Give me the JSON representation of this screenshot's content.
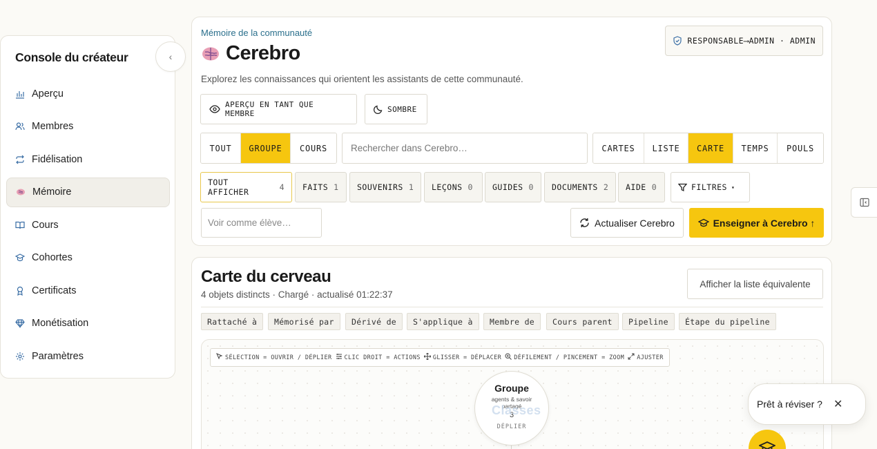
{
  "sidebar": {
    "title": "Console du créateur",
    "collapse_icon": "chevron-left-icon",
    "items": [
      {
        "label": "Aperçu",
        "icon": "bar-chart-icon"
      },
      {
        "label": "Membres",
        "icon": "users-icon"
      },
      {
        "label": "Fidélisation",
        "icon": "repeat-icon"
      },
      {
        "label": "Mémoire",
        "icon": "brain-icon",
        "active": true
      },
      {
        "label": "Cours",
        "icon": "book-icon"
      },
      {
        "label": "Cohortes",
        "icon": "graduation-cap-icon"
      },
      {
        "label": "Certificats",
        "icon": "award-icon"
      },
      {
        "label": "Monétisation",
        "icon": "gem-icon"
      },
      {
        "label": "Paramètres",
        "icon": "gear-icon"
      }
    ]
  },
  "header": {
    "eyebrow": "Mémoire de la communauté",
    "title": "Cerebro",
    "description": "Explorez les connaissances qui orientent les assistants de cette communauté.",
    "role_badge": "RESPONSABLE⟶ADMIN · ADMIN",
    "preview_btn": "APERÇU EN TANT QUE MEMBRE",
    "theme_btn": "SOMBRE"
  },
  "scope_tabs": [
    "TOUT",
    "GROUPE",
    "COURS"
  ],
  "scope_active": "GROUPE",
  "search": {
    "placeholder": "Rechercher dans Cerebro…"
  },
  "view_tabs": [
    "CARTES",
    "LISTE",
    "CARTE",
    "TEMPS",
    "POULS"
  ],
  "view_active": "CARTE",
  "filters": [
    {
      "label": "TOUT AFFICHER",
      "count": "4"
    },
    {
      "label": "FAITS",
      "count": "1"
    },
    {
      "label": "SOUVENIRS",
      "count": "1"
    },
    {
      "label": "LEÇONS",
      "count": "0"
    },
    {
      "label": "GUIDES",
      "count": "0"
    },
    {
      "label": "DOCUMENTS",
      "count": "2"
    },
    {
      "label": "AIDE",
      "count": "0"
    }
  ],
  "filters_btn": "FILTRES",
  "student_input": {
    "placeholder": "Voir comme élève…"
  },
  "refresh_btn": "Actualiser Cerebro",
  "teach_btn": "Enseigner à Cerebro ↑",
  "map": {
    "title": "Carte du cerveau",
    "subtitle": "4 objets distincts · Chargé · actualisé 01:22:37",
    "list_btn": "Afficher la liste équivalente",
    "relations": [
      "Rattaché à",
      "Mémorisé par",
      "Dérivé de",
      "S'applique à",
      "Membre de",
      "Cours parent",
      "Pipeline",
      "Étape du pipeline"
    ],
    "hints": [
      {
        "icon": "pointer-icon",
        "text": "SÉLECTION = OUVRIR / DÉPLIER"
      },
      {
        "icon": "sliders-icon",
        "text": "CLIC DROIT = ACTIONS"
      },
      {
        "icon": "move-icon",
        "text": "GLISSER = DÉPLACER"
      },
      {
        "icon": "zoom-icon",
        "text": "DÉFILEMENT / PINCEMENT = ZOOM"
      },
      {
        "icon": "expand-icon",
        "text": "AJUSTER"
      }
    ],
    "node": {
      "title": "Groupe",
      "description": "agents & savoir partagé",
      "ghost_text": "Classes",
      "count": "3",
      "action": "DÉPLIER"
    }
  },
  "toast": {
    "text": "Prêt à réviser ?",
    "close": "✕"
  },
  "colors": {
    "accent": "#f6c60f",
    "link": "#2a6f8c",
    "background": "#fbfaf6"
  }
}
